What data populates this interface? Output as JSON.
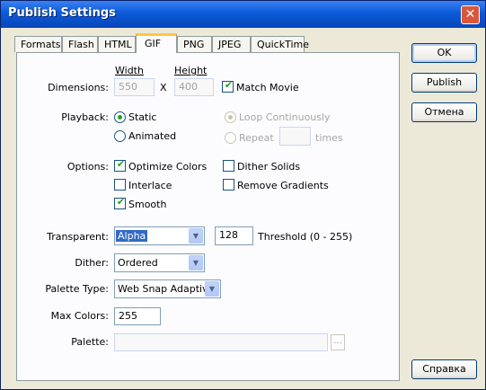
{
  "window": {
    "title": "Publish Settings"
  },
  "tabs": [
    "Formats",
    "Flash",
    "HTML",
    "GIF",
    "PNG",
    "JPEG",
    "QuickTime"
  ],
  "active_tab": "GIF",
  "dimensions": {
    "label": "Dimensions:",
    "width_label": "Width",
    "height_label": "Height",
    "width_value": "550",
    "height_value": "400",
    "x_sep": "X",
    "match_movie_label": "Match Movie",
    "match_movie_checked": true
  },
  "playback": {
    "label": "Playback:",
    "static_label": "Static",
    "animated_label": "Animated",
    "selected": "Static",
    "loop_label": "Loop Continuously",
    "repeat_label": "Repeat",
    "times_label": "times",
    "repeat_value": ""
  },
  "options": {
    "label": "Options:",
    "optimize_colors": {
      "label": "Optimize Colors",
      "checked": true
    },
    "interlace": {
      "label": "Interlace",
      "checked": false
    },
    "smooth": {
      "label": "Smooth",
      "checked": true
    },
    "dither_solids": {
      "label": "Dither Solids",
      "checked": false
    },
    "remove_gradients": {
      "label": "Remove Gradients",
      "checked": false
    }
  },
  "transparent": {
    "label": "Transparent:",
    "value": "Alpha",
    "threshold_value": "128",
    "threshold_label": "Threshold (0 - 255)"
  },
  "dither": {
    "label": "Dither:",
    "value": "Ordered"
  },
  "palette_type": {
    "label": "Palette Type:",
    "value": "Web Snap Adaptive"
  },
  "max_colors": {
    "label": "Max Colors:",
    "value": "255"
  },
  "palette": {
    "label": "Palette:",
    "value": "",
    "browse": "..."
  },
  "buttons": {
    "ok": "OK",
    "publish": "Publish",
    "cancel": "Отмена",
    "help": "Справка"
  },
  "colors": {
    "titlebar": "#0B5AD8",
    "accent_check": "#21A121",
    "tab_highlight": "#FFC83C"
  },
  "icons": {
    "close": "close-icon",
    "dropdown": "chevron-down-icon"
  }
}
